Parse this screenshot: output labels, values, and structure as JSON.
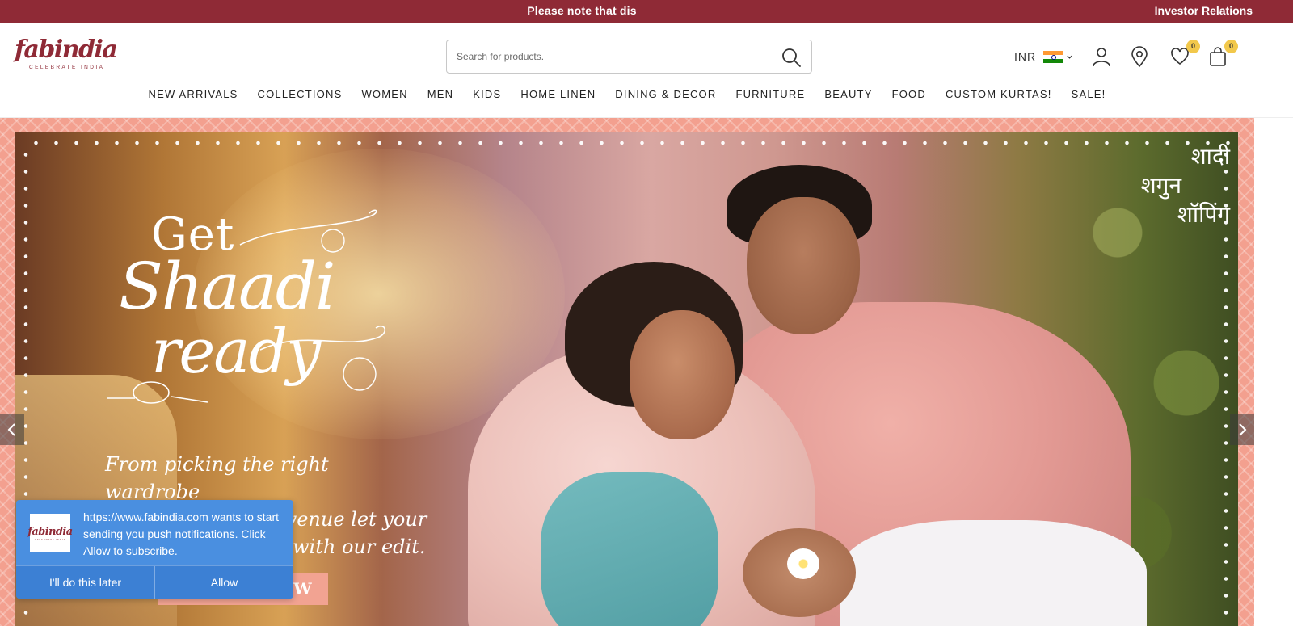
{
  "announcement": {
    "text": "Please note that dis",
    "investor_link": "Investor Relations"
  },
  "brand": {
    "wordmark": "fabindia",
    "tagline": "CELEBRATE INDIA",
    "color": "#8f2a36"
  },
  "search": {
    "placeholder": "Search for products."
  },
  "header": {
    "currency": "INR",
    "wishlist_count": "0",
    "cart_count": "0"
  },
  "nav": {
    "items": [
      "NEW ARRIVALS",
      "COLLECTIONS",
      "WOMEN",
      "MEN",
      "KIDS",
      "HOME LINEN",
      "DINING & DECOR",
      "FURNITURE",
      "BEAUTY",
      "FOOD",
      "CUSTOM KURTAS!",
      "SALE!"
    ]
  },
  "hero": {
    "headline": {
      "line1": "Get",
      "line2": "Shaadi",
      "line3": "ready"
    },
    "hindi": {
      "line1": "शादी",
      "line2": "शगुन",
      "line3": "शॉपिंग"
    },
    "subcopy": {
      "line1": "From picking the right wardrobe",
      "line2": "to decorating the venue let your",
      "line3": "with our edit."
    },
    "cta": "W"
  },
  "push_prompt": {
    "logo_text": "fabindia",
    "logo_tagline": "CELEBRATE INDIA",
    "message": "https://www.fabindia.com wants to start sending you push notifications. Click Allow to subscribe.",
    "later_label": "I'll do this later",
    "allow_label": "Allow",
    "color": "#4a8fe0"
  }
}
